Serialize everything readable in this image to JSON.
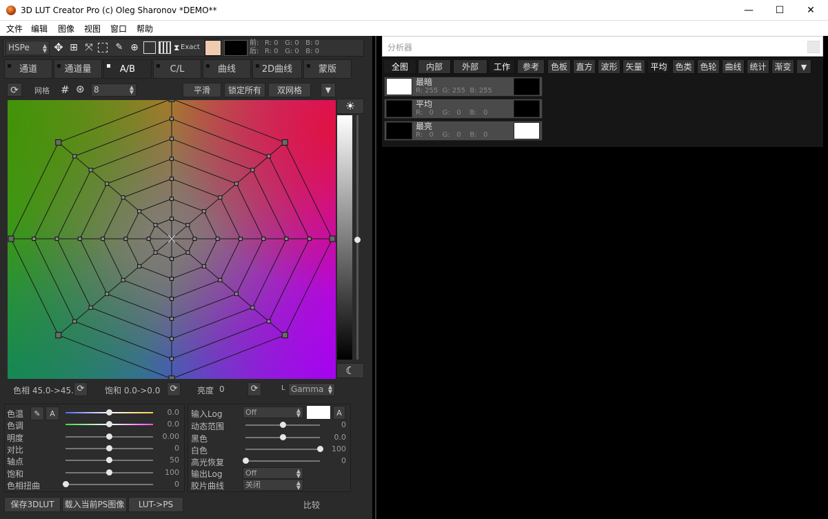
{
  "window": {
    "title": "3D LUT Creator Pro (c) Oleg Sharonov *DEMO**",
    "min": "—",
    "max": "☐",
    "close": "✕"
  },
  "menu": [
    "文件",
    "编辑",
    "图像",
    "视图",
    "窗口",
    "帮助"
  ],
  "toolbar": {
    "colorspace": "HSPe",
    "exact_label": "Exact",
    "swatch_before_color": "#f0cbb0",
    "swatch_after_color": "#000000",
    "before_label": "前:",
    "after_label": "后:",
    "before_values": "R: 0   G: 0   B: 0",
    "after_values": "R: 0   G: 0   B: 0"
  },
  "tabs": [
    "通道",
    "通道量",
    "A/B",
    "C/L",
    "曲线",
    "2D曲线",
    "蒙版"
  ],
  "active_tab": "A/B",
  "grid_bar": {
    "grid_label": "网格",
    "grid_value": "8",
    "smooth": "平滑",
    "lock_all": "锁定所有",
    "double_grid": "双网格"
  },
  "grid_footer": {
    "hue": "色相 45.0->45.0",
    "sat": "饱和 0.0->0.0",
    "bright_label": "亮度",
    "bright_val": "0",
    "l_label": "L",
    "gamma": "Gamma"
  },
  "adjust_left": [
    {
      "label": "色温",
      "value": "0.0",
      "pos": 0.5
    },
    {
      "label": "色调",
      "value": "0.0",
      "pos": 0.5
    },
    {
      "label": "明度",
      "value": "0.00",
      "pos": 0.5
    },
    {
      "label": "对比",
      "value": "0",
      "pos": 0.5
    },
    {
      "label": "轴点",
      "value": "50",
      "pos": 0.5
    },
    {
      "label": "饱和",
      "value": "100",
      "pos": 0.5
    },
    {
      "label": "色相扭曲",
      "value": "0",
      "pos": 0.0
    }
  ],
  "adjust_left_a": "A",
  "adjust_right": {
    "input_log_label": "输入Log",
    "input_log_value": "Off",
    "a": "A",
    "dynamic_label": "动态范围",
    "dynamic_value": "0",
    "dynamic_pos": 0.5,
    "black_label": "黑色",
    "black_value": "0.0",
    "black_pos": 0.5,
    "white_label": "白色",
    "white_value": "100",
    "white_pos": 1.0,
    "highlight_label": "高光恢复",
    "highlight_value": "0",
    "highlight_pos": 0.0,
    "output_log_label": "输出Log",
    "output_log_value": "Off",
    "film_label": "胶片曲线",
    "film_value": "关闭"
  },
  "bottom": {
    "save": "保存3DLUT",
    "load": "载入当前PS图像",
    "lutps": "LUT->PS",
    "compare": "比较"
  },
  "analyzer": {
    "title": "分析器",
    "tabs": [
      "全图",
      "内部",
      "外部",
      "工作",
      "参考",
      "色板",
      "直方",
      "波形",
      "矢量",
      "平均",
      "色类",
      "色轮",
      "曲线",
      "统计",
      "渐变"
    ],
    "rows": [
      {
        "name": "最暗",
        "values": "R: 255  G: 255  B: 255",
        "left_color": "#ffffff",
        "right_color": "#000000"
      },
      {
        "name": "平均",
        "values": "R:   0    G:   0    B:   0",
        "left_color": "#000000",
        "right_color": "#000000"
      },
      {
        "name": "最亮",
        "values": "R:   0    G:   0    B:   0",
        "left_color": "#000000",
        "right_color": "#ffffff"
      }
    ]
  }
}
